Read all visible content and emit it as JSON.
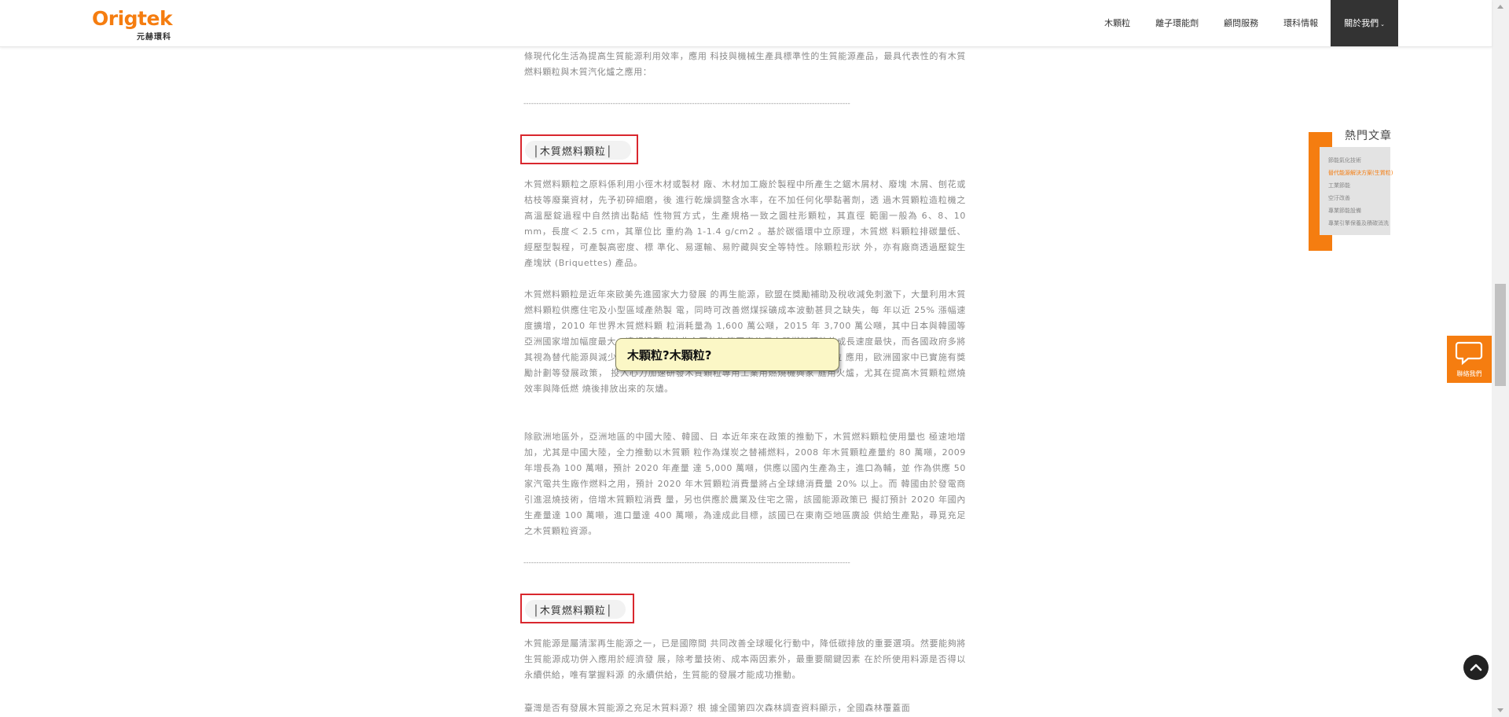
{
  "header": {
    "logo_text": "Origtek",
    "logo_subtext": "元赫環科",
    "nav": [
      "木顆粒",
      "離子環能劑",
      "顧問服務",
      "環科情報",
      "關於我們"
    ],
    "active_nav": "關於我們"
  },
  "article": {
    "intro": "條現代化生活為提高生質能源利用效率，應用 科技與機械生產具標準性的生質能源產品，最具代表性的有木質燃料顆粒與木質汽化爐之應用：",
    "divider": "--------------------------------------------------------------------------------------------------------------------------------",
    "section1": {
      "heading": "木質燃料顆粒",
      "p1": "木質燃料顆粒之原料係利用小徑木材或製材 廠、木材加工廠於製程中所產生之鋸木屑材、廢塊 木屑、刨花或枯枝等廢棄資材，先予初碎細磨，後 進行乾燥調整含水率，在不加任何化學黏著劑，透 過木質顆粒造粒機之高溫壓錠過程中自然擠出黏結 性物質方式，生產規格一致之圓柱形顆粒，其直徑 範圍一般為 6、8、10 mm，長度＜ 2.5 cm，其單位比 重約為 1-1.4 g/cm2 。基於碳循環中立原理，木質燃 料顆粒排碳量低、經壓型製程，可產製高密度、標 準化、易運輸、易貯藏與安全等特性。除顆粒形狀 外，亦有廠商透過壓錠生產塊狀 (Briquettes) 產品。",
      "p2": "木質燃料顆粒是近年來歐美先進國家大力發展 的再生能源，歐盟在獎勵補助及稅收減免刺激下，大量利用木質燃料顆粒供應住宅及小型區域產熱製 電，同時可改善燃煤採礦成本波動甚貝之缺失，每 年以近 25% 漲幅速度擴增，2010 年世界木質燃料顆 粒消耗量為 1,600 萬公噸，2015 年 3,700 萬公噸，其中日本與韓國等亞洲國家增加幅度最大，遠超過歐洲這些主要的海等國家使用木質燃料顆粒的成長速度最快，而各國政府多將其視為替代能源與減少溫室 氣體的主要計劃之一，為了快速推動木質燃料顆粒 應用，歐洲國家中已實施有獎勵計劃等發展政策， 投入心力加速研發木質顆粒專用工業用燃燒機與家 庭用火爐，尤其在提高木質顆粒燃燒效率與降低燃 燒後排放出來的灰燼。",
      "p3": "除歐洲地區外，亞洲地區的中國大陸、韓國、日 本近年來在政策的推動下，木質燃料顆粒使用量也 極速地增加，尤其是中國大陸，全力推動以木質顆 粒作為煤炭之替補燃料，2008 年木質顆粒產量約 80 萬噸，2009 年增長為 100 萬噸，預計 2020 年產量 達 5,000 萬噸，供應以國內生產為主，進口為輔，並 作為供應 50 家汽電共生廠作燃料之用，預計 2020 年木質顆粒消費量將占全球總消費量 20% 以上。而 韓國由於發電商引進混燒技術，倍增木質顆粒消費 量，另也供應於農業及住宅之需，該國能源政策已 擬訂預計 2020 年國內生產量達 100 萬噸，進口量達 400 萬噸，為達成此目標，該國已在東南亞地區廣設 供給生產點，尋覓充足之木質顆粒資源。"
    },
    "section2": {
      "heading": "木質燃料顆粒",
      "p1": "木質能源是屬清潔再生能源之一，已是國際間 共同改善全球暖化行動中，降低碳排放的重要選項。然要能夠將生質能源成功併入應用於經濟發 展，除考量技術、成本兩因素外，最重要關鍵因素 在於所使用料源是否得以永續供給，唯有掌握料源 的永續供給，生質能的發展才能成功推動。",
      "p2": "臺灣是否有發展木質能源之充足木質料源？根 據全國第四次森林調查資料顯示，全國森林覆蓋面"
    }
  },
  "sidebar": {
    "title": "熱門文章",
    "items": [
      {
        "label": "節能氣化技術",
        "hot": false
      },
      {
        "label": "替代能源解決方案(生質粒)",
        "hot": true
      },
      {
        "label": "工業節能",
        "hot": false
      },
      {
        "label": "空汙改善",
        "hot": false
      },
      {
        "label": "專業節能設備",
        "hot": false
      },
      {
        "label": "專業引擎保養及積碳消洗",
        "hot": false
      }
    ]
  },
  "tooltip": {
    "text": "木顆粒?木顆粒?"
  },
  "contact": {
    "label": "聯絡我們"
  },
  "colors": {
    "brand": "#f57d10",
    "heading_frame": "#d9272e",
    "nav_active_bg": "#333333"
  }
}
